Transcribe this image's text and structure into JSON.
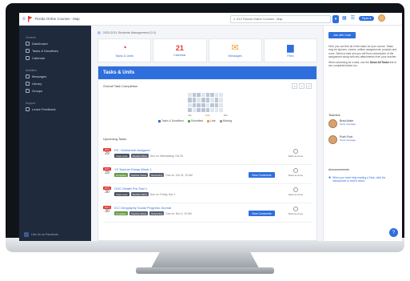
{
  "app": {
    "brand": "Florida Online Courses - Map",
    "search_value": "K12 Florida Online Courses - Map",
    "user_label": "Ryan"
  },
  "sidebar": {
    "sections": [
      {
        "heading": "General",
        "items": [
          "Dashboard",
          "Tasks & Deadlines",
          "Calendar"
        ]
      },
      {
        "heading": "Activities",
        "items": [
          "Messages",
          "Library",
          "Groups"
        ]
      },
      {
        "heading": "Support",
        "items": [
          "Leave Feedback"
        ]
      }
    ],
    "footer": "Like Us on Facebook"
  },
  "main": {
    "breadcrumb": "2020-2021 Students Management (2.0)",
    "shortcuts": [
      {
        "label": "Tasks & Units",
        "icon": "pie-chart-icon",
        "color": "#e53935",
        "glyph": "◔"
      },
      {
        "label": "Calendar",
        "icon": "calendar-icon",
        "color": "#e53935",
        "glyph": "21"
      },
      {
        "label": "Messages",
        "icon": "envelope-icon",
        "color": "#f0a030",
        "glyph": "✉"
      },
      {
        "label": "Files",
        "icon": "folder-icon",
        "color": "#2f6fdd",
        "glyph": "▆"
      }
    ],
    "card_title": "Tasks & Units",
    "overall_label": "Overall Task Completion",
    "months": [
      "Jan",
      "Feb",
      "Mar"
    ],
    "legend": [
      {
        "label": "Tasks & Deadlines",
        "color": "#2f6fdd"
      },
      {
        "label": "Submitted",
        "color": "#4caf50"
      },
      {
        "label": "Late",
        "color": "#f0a030"
      },
      {
        "label": "Missing",
        "color": "#999999"
      }
    ],
    "upcoming_label": "Upcoming Tasks",
    "tasks": [
      {
        "month": "OCT",
        "day": "29",
        "title": "P.E. Worksheet Assigned",
        "tags": [
          "Class work",
          "Student Work"
        ],
        "date": "Due on: Wednesday, Oct 30",
        "button": "",
        "mark": "Mark as done"
      },
      {
        "month": "OCT",
        "day": "29",
        "title": "Y9 Teacher Essay Week 1",
        "tags": [
          "Complete",
          "Teacher Notes",
          "Read Only"
        ],
        "date": "Due on: Oct 31, 10 AM",
        "button": "View Comments",
        "mark": "Mark as done"
      },
      {
        "month": "OCT",
        "day": "30",
        "title": "OOC Health Pre-Test 1",
        "tags": [
          "Class work",
          "Student Work"
        ],
        "date": "Due on: Friday, Nov 1",
        "button": "",
        "mark": "Mark as done"
      },
      {
        "month": "OCT",
        "day": "30",
        "title": "ICC Geography Social Progress Journal",
        "tags": [
          "Complete",
          "Teacher Notes",
          "Read Only"
        ],
        "date": "Due on: Nov 4, 10 AM",
        "button": "View Comments",
        "mark": "Mark as done"
      }
    ]
  },
  "right": {
    "button": "Join with Code",
    "intro": "Here you can find all of the tasks for your course. Tasks may be quizzes, exams, written assignments, projects and more. Select a task and you will find a description of the assignment along with any attachments from your teacher.",
    "tip_prefix": "When searching for a task, use the ",
    "tip_bold": "Show All Tasks",
    "tip_suffix": " link to see completed tasks too.",
    "teachers_heading": "Teachers",
    "teachers": [
      {
        "name": "Brad Azike",
        "sub": "Send message"
      },
      {
        "name": "Ruth Ford",
        "sub": "Send message"
      }
    ],
    "ann_heading": "Announcements",
    "announcement": "When you need help reading a Task, click the microphone to read it aloud.",
    "fab": "?"
  }
}
